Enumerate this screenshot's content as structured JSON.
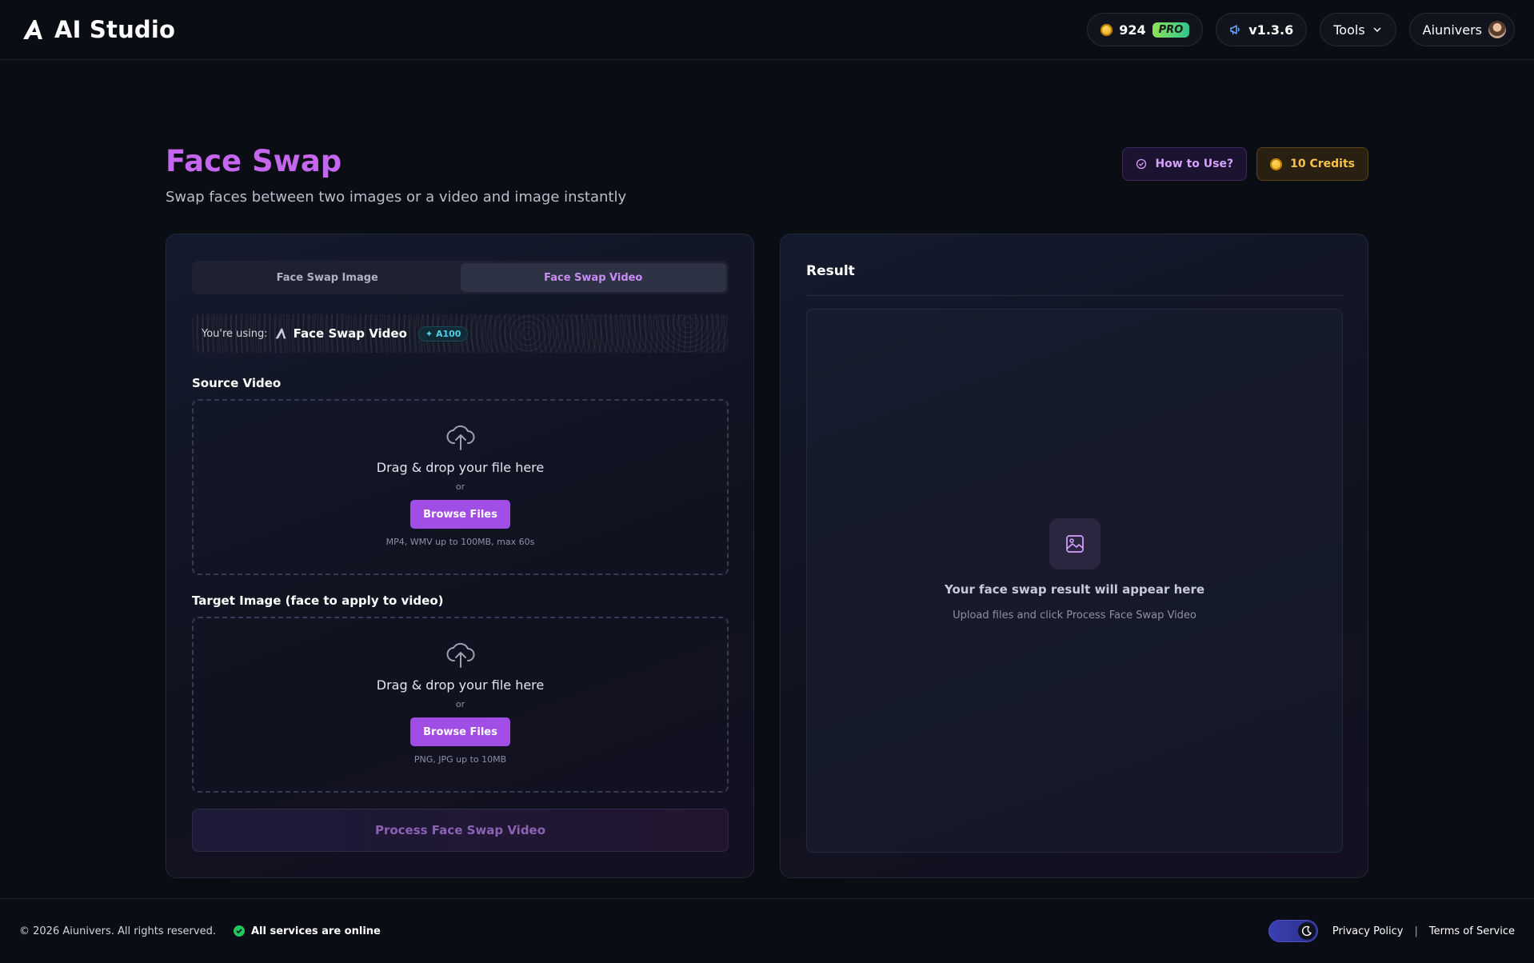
{
  "header": {
    "brand_name": "AI Studio",
    "coins": "924",
    "pro_label": "PRO",
    "version": "v1.3.6",
    "tools_label": "Tools",
    "username": "Aiunivers"
  },
  "page": {
    "title": "Face Swap",
    "subtitle": "Swap faces between two images or a video and image instantly",
    "how_to_use": "How to Use?",
    "credits": "10 Credits"
  },
  "tabs": [
    {
      "label": "Face Swap Image",
      "active": false
    },
    {
      "label": "Face Swap Video",
      "active": true
    }
  ],
  "using": {
    "label": "You're using:",
    "name": "Face Swap Video",
    "gpu_badge": "A100"
  },
  "source": {
    "label": "Source Video",
    "drop_text": "Drag & drop your file here",
    "or_text": "or",
    "browse_label": "Browse Files",
    "hint": "MP4, WMV up to 100MB, max 60s"
  },
  "target": {
    "label": "Target Image (face to apply to video)",
    "drop_text": "Drag & drop your file here",
    "or_text": "or",
    "browse_label": "Browse Files",
    "hint": "PNG, JPG up to 10MB"
  },
  "process_label": "Process Face Swap Video",
  "result": {
    "title": "Result",
    "main_text": "Your face swap result will appear here",
    "sub_text": "Upload files and click Process Face Swap Video"
  },
  "footer": {
    "copyright": "© 2026 Aiunivers. All rights reserved.",
    "status": "All services are online",
    "privacy": "Privacy Policy",
    "separator": "|",
    "terms": "Terms of Service"
  },
  "colors": {
    "accent_purple": "#a14ee6",
    "title_purple": "#c466ee",
    "status_green": "#22c55e",
    "credits_gold": "#f6c24a"
  },
  "icons": {
    "brand": "brand-logo-icon",
    "coin": "coin-icon",
    "version": "megaphone-icon",
    "tools": "chevron-down-icon",
    "upload": "cloud-upload-icon",
    "result": "image-icon",
    "theme": "moon-icon"
  }
}
